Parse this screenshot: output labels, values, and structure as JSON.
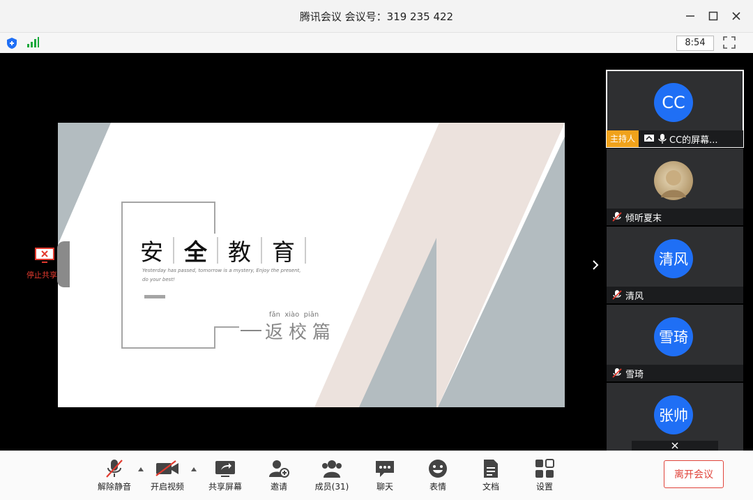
{
  "window": {
    "title": "腾讯会议 会议号：319 235 422"
  },
  "status": {
    "time": "8:54"
  },
  "slide": {
    "title_chars": [
      "安",
      "全",
      "教",
      "育"
    ],
    "subtitle_en": "Yesterday has passed, tomorrow is a mystery, Enjoy the present,",
    "subtitle_en2": "do your best!",
    "pinyin": "fǎn  xiào  piān",
    "subtitle_cn": "返校篇"
  },
  "share_control": {
    "label": "停止共享"
  },
  "participants": [
    {
      "name": "CC的屏幕...",
      "avatar": "CC",
      "host_tag": "主持人"
    },
    {
      "name": "倾听夏末",
      "avatar": "photo"
    },
    {
      "name": "清风",
      "avatar": "清风"
    },
    {
      "name": "雪琦",
      "avatar": "雪琦"
    },
    {
      "name": "",
      "avatar": "张帅"
    }
  ],
  "toolbar": {
    "unmute": "解除静音",
    "video": "开启视频",
    "share": "共享屏幕",
    "invite": "邀请",
    "members": "成员(31)",
    "chat": "聊天",
    "emoji": "表情",
    "docs": "文档",
    "settings": "设置",
    "leave": "离开会议"
  },
  "colors": {
    "accent": "#1f6ff5",
    "host": "#f0a21b",
    "danger": "#e0433a"
  }
}
